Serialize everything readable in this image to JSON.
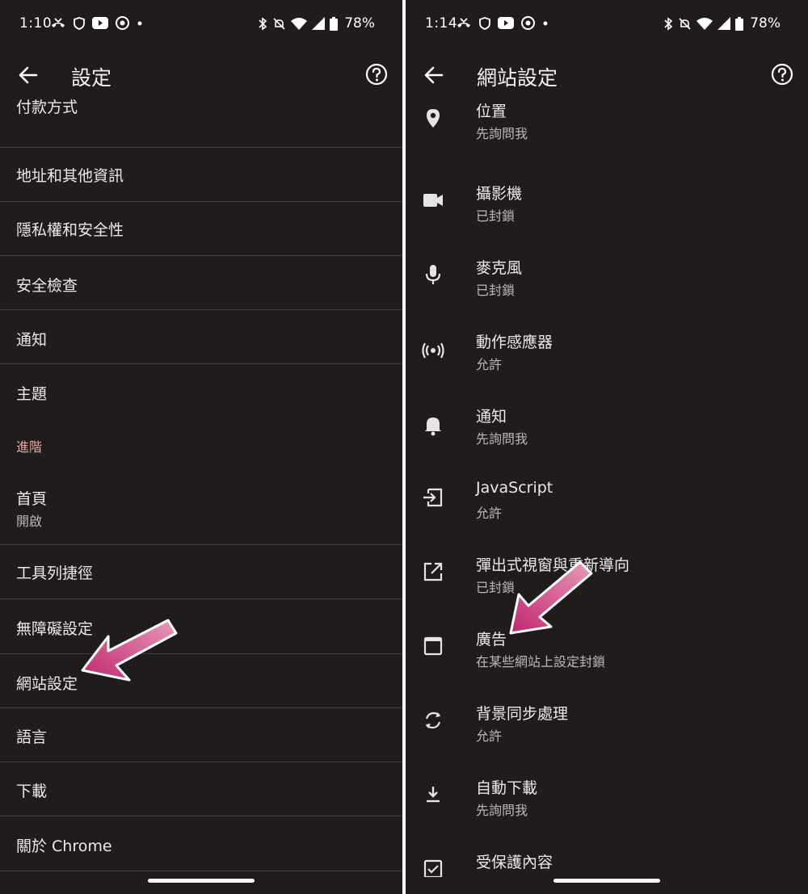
{
  "left": {
    "status": {
      "time": "1:10",
      "battery": "78%"
    },
    "title": "設定",
    "items": [
      {
        "label": "付款方式"
      },
      {
        "label": "地址和其他資訊"
      },
      {
        "label": "隱私權和安全性"
      },
      {
        "label": "安全檢查"
      },
      {
        "label": "通知"
      },
      {
        "label": "主題"
      }
    ],
    "section_header": "進階",
    "advanced_items": [
      {
        "label": "首頁",
        "sub": "開啟"
      },
      {
        "label": "工具列捷徑"
      },
      {
        "label": "無障礙設定"
      },
      {
        "label": "網站設定"
      },
      {
        "label": "語言"
      },
      {
        "label": "下載"
      },
      {
        "label": "關於 Chrome"
      }
    ]
  },
  "right": {
    "status": {
      "time": "1:14",
      "battery": "78%"
    },
    "title": "網站設定",
    "items": [
      {
        "icon": "location-icon",
        "label": "位置",
        "sub": "先詢問我"
      },
      {
        "icon": "camera-icon",
        "label": "攝影機",
        "sub": "已封鎖"
      },
      {
        "icon": "microphone-icon",
        "label": "麥克風",
        "sub": "已封鎖"
      },
      {
        "icon": "motion-sensor-icon",
        "label": "動作感應器",
        "sub": "允許"
      },
      {
        "icon": "bell-icon",
        "label": "通知",
        "sub": "先詢問我"
      },
      {
        "icon": "javascript-icon",
        "label": "JavaScript",
        "sub": "允許"
      },
      {
        "icon": "popup-icon",
        "label": "彈出式視窗與重新導向",
        "sub": "已封鎖"
      },
      {
        "icon": "ads-icon",
        "label": "廣告",
        "sub": "在某些網站上設定封鎖"
      },
      {
        "icon": "sync-icon",
        "label": "背景同步處理",
        "sub": "允許"
      },
      {
        "icon": "download-icon",
        "label": "自動下載",
        "sub": "先詢問我"
      },
      {
        "icon": "protected-content-icon",
        "label": "受保護內容",
        "sub": ""
      }
    ]
  }
}
